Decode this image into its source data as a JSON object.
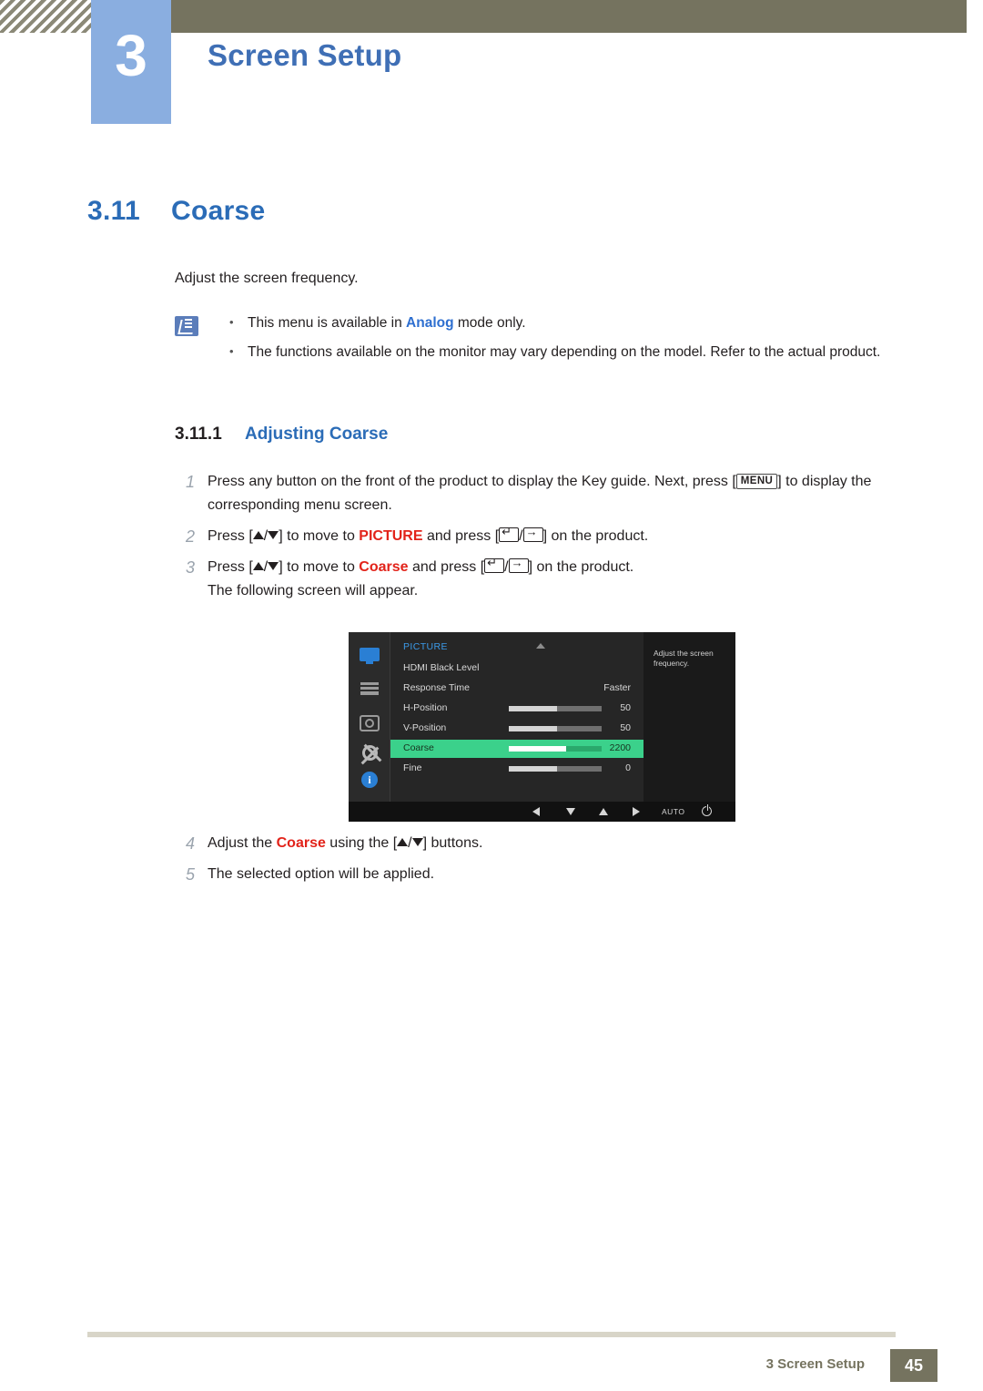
{
  "header": {
    "chapter_number": "3",
    "chapter_title": "Screen Setup"
  },
  "section": {
    "number": "3.11",
    "title": "Coarse",
    "intro": "Adjust the screen frequency."
  },
  "notes": {
    "icon": "note-icon",
    "items": [
      {
        "pre": "This menu is available in ",
        "emph": "Analog",
        "post": " mode only."
      },
      {
        "pre": "The functions available on the monitor may vary depending on the model. Refer to the actual product.",
        "emph": "",
        "post": ""
      }
    ]
  },
  "subsection": {
    "number": "3.11.1",
    "title": "Adjusting Coarse"
  },
  "steps": [
    {
      "n": "1",
      "html": "Press any button on the front of the product to display the Key guide. Next, press [<span class=\"key\">MENU</span>] to display the corresponding menu screen."
    },
    {
      "n": "2",
      "html": "Press [<span class=\"tri-up\"></span>/<span class=\"tri-dn\"></span>] to move to <span class=\"emph-red\">PICTURE</span> and press [<span class=\"keyicon ret\"></span>/<span class=\"keyicon arrow\"></span>] on the product."
    },
    {
      "n": "3",
      "html": "Press [<span class=\"tri-up\"></span>/<span class=\"tri-dn\"></span>] to move to <span class=\"emph-red\">Coarse</span> and press [<span class=\"keyicon ret\"></span>/<span class=\"keyicon arrow\"></span>] on the product."
    }
  ],
  "step3_sub": "The following screen will appear.",
  "steps_after": [
    {
      "n": "4",
      "html": "Adjust the <span class=\"emph-red\">Coarse</span> using the [<span class=\"tri-up\"></span>/<span class=\"tri-dn\"></span>] buttons."
    },
    {
      "n": "5",
      "html": "The selected option will be applied."
    }
  ],
  "osd": {
    "menu_title": "PICTURE",
    "side_icons": [
      "monitor-icon",
      "bars-icon",
      "brightness-icon",
      "gear-icon",
      "info-icon"
    ],
    "rows": [
      {
        "label": "HDMI Black Level",
        "value": "",
        "bar": null
      },
      {
        "label": "Response Time",
        "value": "Faster",
        "bar": null
      },
      {
        "label": "H-Position",
        "value": "50",
        "bar": 50
      },
      {
        "label": "V-Position",
        "value": "50",
        "bar": 50
      },
      {
        "label": "Coarse",
        "value": "2200",
        "bar": 62,
        "selected": true
      },
      {
        "label": "Fine",
        "value": "0",
        "bar": 0
      }
    ],
    "help_text": "Adjust the screen frequency.",
    "bottom_bar": {
      "auto_label": "AUTO",
      "icons": [
        "left-arrow-icon",
        "down-arrow-icon",
        "up-arrow-icon",
        "right-arrow-icon",
        "auto-label",
        "power-icon"
      ]
    }
  },
  "footer": {
    "text": "3 Screen Setup",
    "page": "45"
  }
}
